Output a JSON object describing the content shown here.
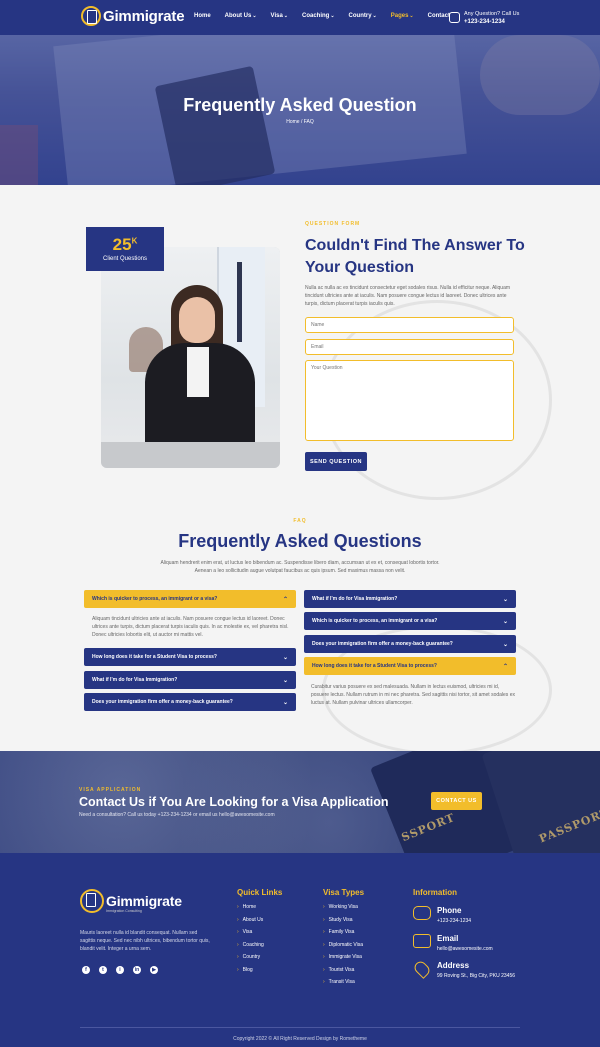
{
  "header": {
    "logo_text": "Gimmigrate",
    "nav": [
      {
        "label": "Home",
        "caret": false,
        "active": false
      },
      {
        "label": "About Us",
        "caret": true,
        "active": false
      },
      {
        "label": "Visa",
        "caret": true,
        "active": false
      },
      {
        "label": "Coaching",
        "caret": true,
        "active": false
      },
      {
        "label": "Country",
        "caret": true,
        "active": false
      },
      {
        "label": "Pages",
        "caret": true,
        "active": true
      },
      {
        "label": "Contact",
        "caret": false,
        "active": false
      }
    ],
    "contact_label": "Any Question? Call Us",
    "contact_phone": "+123-234-1234"
  },
  "hero": {
    "title": "Frequently Asked Question",
    "breadcrumb": "Home / FAQ"
  },
  "badge": {
    "number": "25",
    "suffix": "K",
    "label": "Client Questions"
  },
  "question_form": {
    "label": "QUESTION FORM",
    "title": "Couldn't Find The Answer To Your Question",
    "description": "Nulla ac nulla ac ex tincidunt consectetur eget sodales risus. Nulla id efficitur neque. Aliquam tincidunt ultricies ante at iaculis. Nam posuere congue lectus id laoreet. Donec ultrices ante turpis, dictum placerat turpis iaculis quis.",
    "name_placeholder": "Name",
    "email_placeholder": "Email",
    "question_placeholder": "Your Question",
    "send_button": "SEND QUESTION"
  },
  "faq": {
    "label": "FAQ",
    "title": "Frequently Asked Questions",
    "description": "Aliquam hendrerit enim erat, ut luctus leo bibendum ac. Suspendisse libero diam, accumsan ut ex et, consequat lobortis tortor. Aenean a leo sollicitudin augue volutpat faucibus ac quis ipsum. Sed maximus massa non velit.",
    "left": [
      {
        "q": "Which is quicker to process, an immigrant or a visa?",
        "open": true,
        "answer": "Aliquam tincidunt ultricies ante at iaculis. Nam posuere congue lectus id laoreet. Donec ultrices ante turpis, dictum placerat turpis iaculis quis. In ac molestie ex, vel pharetra nisl. Donec ultricies lobortis elit, ut auctor mi mattis vel."
      },
      {
        "q": "How long does it take for a Student Visa to process?",
        "open": false
      },
      {
        "q": "What if I'm do for Visa Immigration?",
        "open": false
      },
      {
        "q": "Does your immigration firm offer a money-back guarantee?",
        "open": false
      }
    ],
    "right": [
      {
        "q": "What if I'm do for Visa Immigration?",
        "open": false
      },
      {
        "q": "Which is quicker to process, an immigrant or a visa?",
        "open": false
      },
      {
        "q": "Does your immigration firm offer a money-back guarantee?",
        "open": false
      },
      {
        "q": "How long does it take for a Student Visa to process?",
        "open": true,
        "answer": "Curabitur varius posuere ex sed malesuada. Nullam in lectus euismod, ultricies mi id, posuere lectus. Nullam rutrum in mi nec pharetra. Sed sagittis nisi tortor, sit amet sodales ex luctus at. Nullam pulvinar ultrices ullamcorper."
      }
    ]
  },
  "banner": {
    "label": "VISA APPLICATION",
    "title": "Contact Us if You Are Looking for a Visa Application",
    "subtitle": "Need a consultation? Call us today +123-234-1234 or email us hello@awesomesite.com",
    "button": "CONTACT US",
    "passport_text_1": "PASSPORT",
    "passport_text_2": "SSPORT"
  },
  "footer": {
    "logo_text": "Gimmigrate",
    "tagline": "Immigration Consulting",
    "description": "Mauris laoreet nulla id blandit consequat. Nullam sed sagittis neque. Sed nec nibh ultrices, bibendum tortor quis, blandit velit. Integer a urna sem.",
    "socials": [
      "f",
      "t",
      "i",
      "in",
      "▶"
    ],
    "quick_links_title": "Quick Links",
    "quick_links": [
      "Home",
      "About Us",
      "Visa",
      "Coaching",
      "Country",
      "Blog"
    ],
    "visa_types_title": "Visa Types",
    "visa_types": [
      "Working Visa",
      "Study Visa",
      "Family Visa",
      "Diplomatic Visa",
      "Immigrate Visa",
      "Tourist Visa",
      "Transit Visa"
    ],
    "information_title": "Information",
    "phone_label": "Phone",
    "phone_value": "+123-234-1234",
    "email_label": "Email",
    "email_value": "hello@awesomesite.com",
    "address_label": "Address",
    "address_value": "99 Roving St., Big City, PKU 23456",
    "copyright": "Copyright 2022 © All Right Reserved Design by Rometheme"
  },
  "colors": {
    "navy": "#263583",
    "gold": "#f2bd2b"
  }
}
